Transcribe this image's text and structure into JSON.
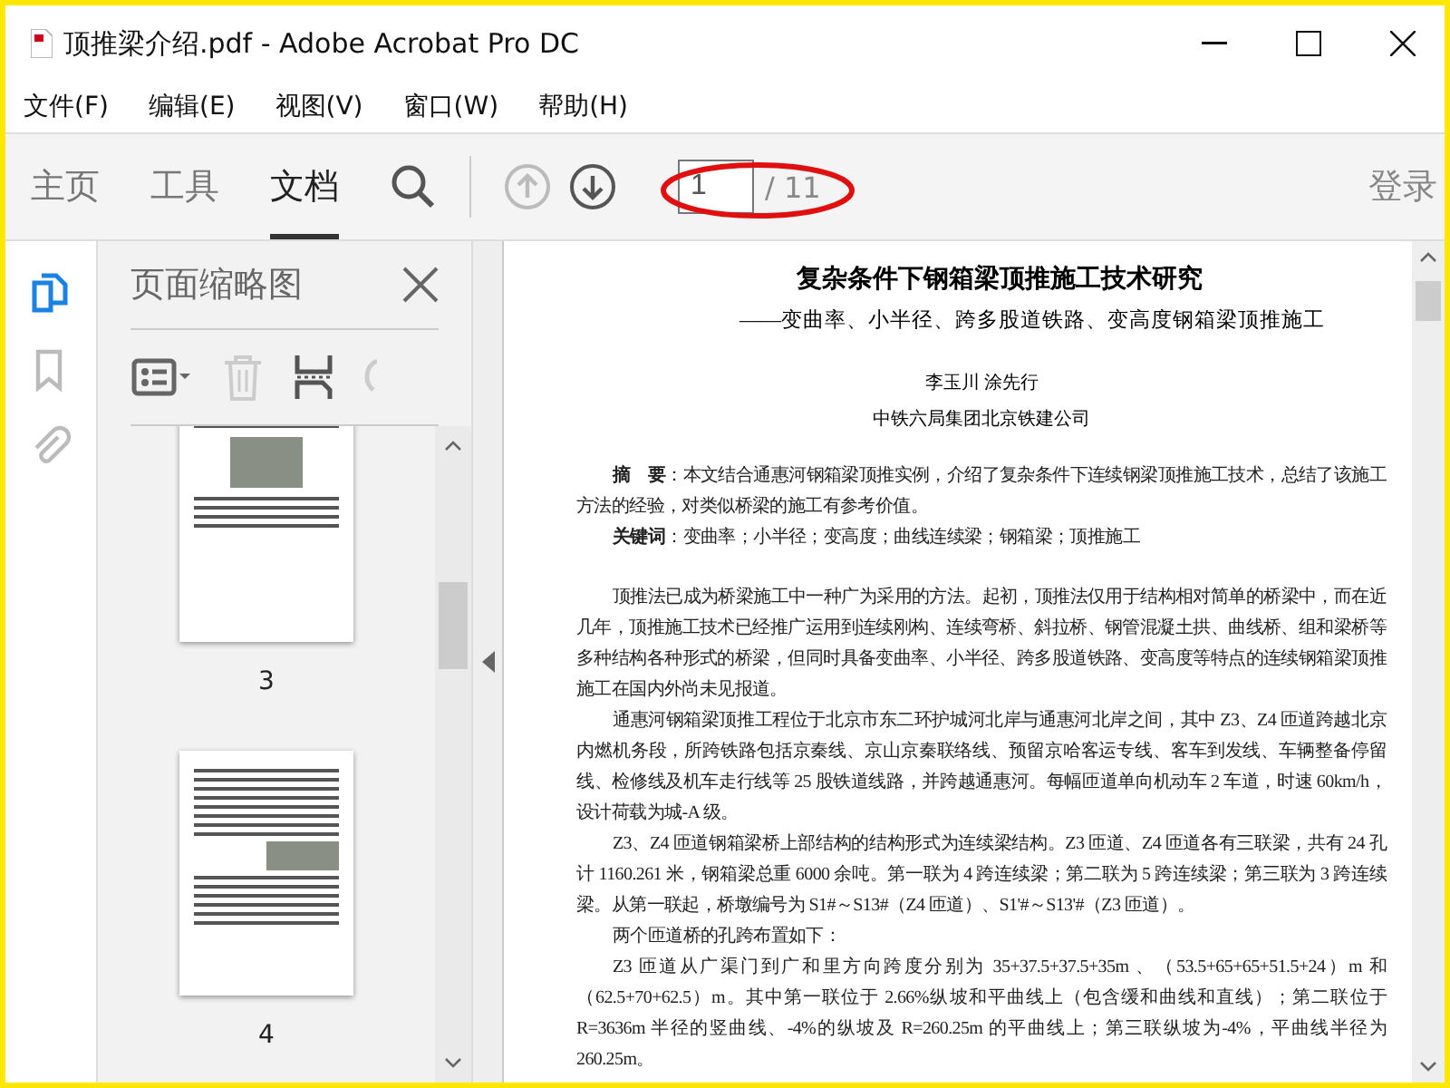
{
  "window": {
    "title": "顶推梁介绍.pdf - Adobe Acrobat Pro DC"
  },
  "menu": [
    "文件(F)",
    "编辑(E)",
    "视图(V)",
    "窗口(W)",
    "帮助(H)"
  ],
  "toolbar": {
    "tabs": [
      {
        "label": "主页",
        "selected": false
      },
      {
        "label": "工具",
        "selected": false
      },
      {
        "label": "文档",
        "selected": true
      }
    ],
    "nav": [
      {
        "kind": "up",
        "disabled": true
      },
      {
        "kind": "down",
        "disabled": false
      }
    ],
    "page_field": {
      "value": "1"
    },
    "page_total": "/ 11",
    "sign_in": "登录"
  },
  "side_rail": [
    {
      "kind": "pages",
      "selected": true
    },
    {
      "kind": "bookmark",
      "selected": false
    },
    {
      "kind": "attachment",
      "selected": false
    }
  ],
  "thumbnails_panel": {
    "title": "页面缩略图",
    "pages": [
      {
        "label": "3",
        "kind": "photo-top"
      },
      {
        "label": "4",
        "kind": "photo-side"
      }
    ]
  },
  "document": {
    "title": "复杂条件下钢箱梁顶推施工技术研究",
    "subtitle": "——变曲率、小半径、跨多股道铁路、变高度钢箱梁顶推施工",
    "authors": "李玉川 涂先行",
    "affiliation": "中铁六局集团北京铁建公司",
    "paragraphs": [
      "**摘　要**：本文结合通惠河钢箱梁顶推实例，介绍了复杂条件下连续钢梁顶推施工技术，总结了该施工方法的经验，对类似桥梁的施工有参考价值。",
      "**关键词**：变曲率；小半径；变高度；曲线连续梁；钢箱梁；顶推施工",
      "顶推法已成为桥梁施工中一种广为采用的方法。起初，顶推法仅用于结构相对简单的桥梁中，而在近几年，顶推施工技术已经推广运用到连续刚构、连续弯桥、斜拉桥、钢管混凝土拱、曲线桥、组和梁桥等多种结构各种形式的桥梁，但同时具备变曲率、小半径、跨多股道铁路、变高度等特点的连续钢箱梁顶推施工在国内外尚未见报道。",
      "通惠河钢箱梁顶推工程位于北京市东二环护城河北岸与通惠河北岸之间，其中 Z3、Z4 匝道跨越北京内燃机务段，所跨铁路包括京秦线、京山京秦联络线、预留京哈客运专线、客车到发线、车辆整备停留线、检修线及机车走行线等 25 股铁道线路，并跨越通惠河。每幅匝道单向机动车 2 车道，时速 60km/h，设计荷载为城-A 级。",
      "Z3、Z4 匝道钢箱梁桥上部结构的结构形式为连续梁结构。Z3 匝道、Z4 匝道各有三联梁，共有 24 孔计 1160.261 米，钢箱梁总重 6000 余吨。第一联为 4 跨连续梁；第二联为 5 跨连续梁；第三联为 3 跨连续梁。从第一联起，桥墩编号为 S1#～S13#（Z4 匝道）、S1'#～S13'#（Z3 匝道）。",
      "两个匝道桥的孔跨布置如下：",
      "Z3 匝道从广渠门到广和里方向跨度分别为 35+37.5+37.5+35m 、（53.5+65+65+51.5+24）m 和（62.5+70+62.5）m。其中第一联位于 2.66%纵坡和平曲线上（包含缓和曲线和直线）；第二联位于 R=3636m 半径的竖曲线、-4%的纵坡及 R=260.25m 的平曲线上；第三联纵坡为-4%，平曲线半径为 260.25m。"
    ]
  }
}
